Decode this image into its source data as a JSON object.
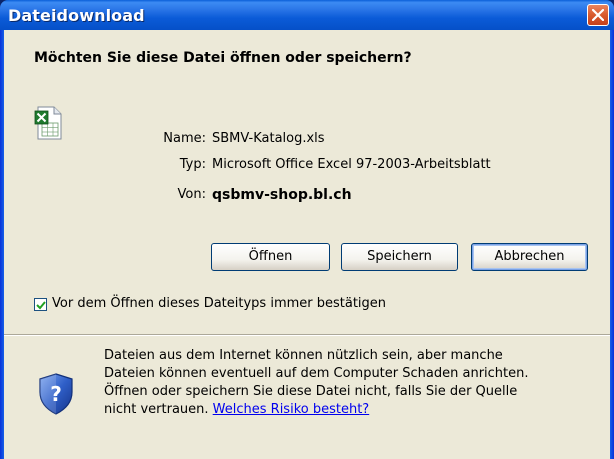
{
  "window": {
    "title": "Dateidownload",
    "close_icon": "close-icon"
  },
  "question": "Möchten Sie diese Datei öffnen oder speichern?",
  "file": {
    "icon": "excel-file-icon",
    "name_label": "Name:",
    "name_value": "SBMV-Katalog.xls",
    "type_label": "Typ:",
    "type_value": "Microsoft Office Excel 97-2003-Arbeitsblatt",
    "from_label": "Von:",
    "from_value": "qsbmv-shop.bl.ch"
  },
  "buttons": {
    "open": "Öffnen",
    "save": "Speichern",
    "cancel": "Abbrechen"
  },
  "checkbox": {
    "checked": true,
    "label": "Vor dem Öffnen dieses Dateityps immer bestätigen"
  },
  "warning": {
    "icon": "security-shield-icon",
    "line1": "Dateien aus dem Internet können nützlich sein, aber manche",
    "line2": "Dateien können eventuell auf dem Computer Schaden anrichten.",
    "line3": "Öffnen oder speichern Sie diese Datei nicht, falls Sie der Quelle",
    "line4_prefix": "nicht vertrauen.",
    "link": "Welches Risiko besteht?"
  },
  "colors": {
    "titlebar": "#0A5FD8",
    "client_bg": "#ECE9D8",
    "close_button": "#D85A2E",
    "link": "#0000EE"
  }
}
